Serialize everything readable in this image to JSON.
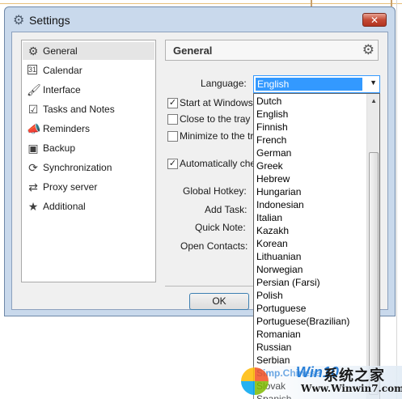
{
  "window": {
    "title": "Settings",
    "close_label": "✕"
  },
  "sidebar": {
    "items": [
      {
        "label": "General",
        "icon": "gear-icon",
        "selected": true
      },
      {
        "label": "Calendar",
        "icon": "calendar-icon"
      },
      {
        "label": "Interface",
        "icon": "brush-icon"
      },
      {
        "label": "Tasks and Notes",
        "icon": "checkbox-icon"
      },
      {
        "label": "Reminders",
        "icon": "megaphone-icon"
      },
      {
        "label": "Backup",
        "icon": "backup-icon"
      },
      {
        "label": "Synchronization",
        "icon": "sync-icon"
      },
      {
        "label": "Proxy server",
        "icon": "proxy-icon"
      },
      {
        "label": "Additional",
        "icon": "star-icon"
      }
    ]
  },
  "general": {
    "title": "General",
    "language_label": "Language:",
    "language_value": "English",
    "start_windows": "Start at Windows",
    "close_tray": "Close to the tray",
    "minimize_tray": "Minimize to the tr",
    "auto_check": "Automatically che",
    "global_hotkey": "Global Hotkey:",
    "add_task": "Add Task:",
    "quick_note": "Quick Note:",
    "open_contacts": "Open Contacts:",
    "start_windows_checked": true,
    "close_tray_checked": false,
    "minimize_tray_checked": false,
    "auto_check_checked": true
  },
  "buttons": {
    "ok": "OK"
  },
  "dropdown": {
    "languages": [
      "Dutch",
      "English",
      "Finnish",
      "French",
      "German",
      "Greek",
      "Hebrew",
      "Hungarian",
      "Indonesian",
      "Italian",
      "Kazakh",
      "Korean",
      "Lithuanian",
      "Norwegian",
      "Persian (Farsi)",
      "Polish",
      "Portuguese",
      "Portuguese(Brazilian)",
      "Romanian",
      "Russian",
      "Serbian",
      "Simp.Chinese",
      "Slovak",
      "Spanish"
    ]
  },
  "watermark": {
    "brand": "Win10",
    "site_cn": "系统之家",
    "url": "Www.Winwin7.com"
  }
}
